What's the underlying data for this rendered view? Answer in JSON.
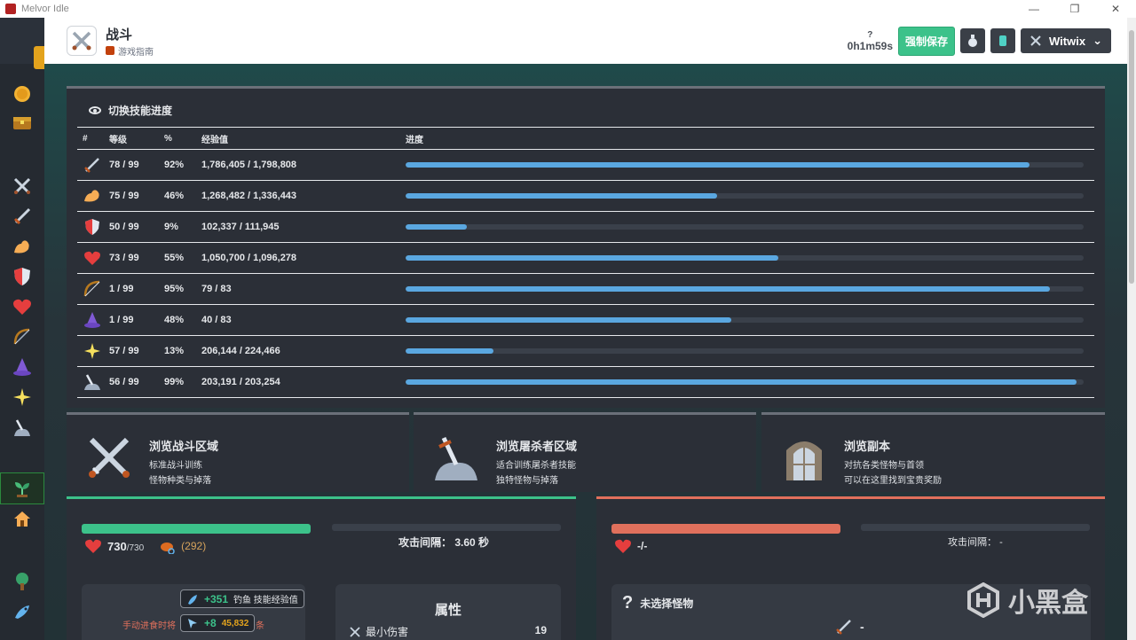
{
  "window": {
    "title": "Melvor Idle"
  },
  "header": {
    "page_title": "战斗",
    "guide_label": "游戏指南",
    "timer_help": "?",
    "timer": "0h1m59s",
    "save_button": "强制保存",
    "username": "Witwix",
    "dropdown_icon": "chevron-down-icon"
  },
  "sidebar": {
    "items": [
      "gp-coin-icon",
      "bank-chest-icon",
      "combat-swords-icon",
      "attack-sword-icon",
      "strength-arm-icon",
      "defence-shield-icon",
      "hitpoints-heart-icon",
      "ranged-bow-icon",
      "magic-hat-icon",
      "prayer-sparkle-icon",
      "slayer-sword-rock-icon",
      "farming-sprout-icon",
      "township-icon",
      "woodcutting-tree-icon",
      "fishing-icon"
    ]
  },
  "skills_panel": {
    "toggle_label": "切换技能进度",
    "headers": {
      "num": "#",
      "level": "等级",
      "percent": "%",
      "xp": "经验值",
      "progress": "进度"
    },
    "rows": [
      {
        "icon": "attack-sword-icon",
        "level": "78 / 99",
        "percent": "92%",
        "xp": "1,786,405 / 1,798,808",
        "progress": 0.92
      },
      {
        "icon": "strength-arm-icon",
        "level": "75 / 99",
        "percent": "46%",
        "xp": "1,268,482 / 1,336,443",
        "progress": 0.46
      },
      {
        "icon": "defence-shield-icon",
        "level": "50 / 99",
        "percent": "9%",
        "xp": "102,337 / 111,945",
        "progress": 0.09
      },
      {
        "icon": "hitpoints-heart-icon",
        "level": "73 / 99",
        "percent": "55%",
        "xp": "1,050,700 / 1,096,278",
        "progress": 0.55
      },
      {
        "icon": "ranged-bow-icon",
        "level": "1 / 99",
        "percent": "95%",
        "xp": "79 / 83",
        "progress": 0.95
      },
      {
        "icon": "magic-hat-icon",
        "level": "1 / 99",
        "percent": "48%",
        "xp": "40 / 83",
        "progress": 0.48
      },
      {
        "icon": "prayer-sparkle-icon",
        "level": "57 / 99",
        "percent": "13%",
        "xp": "206,144 / 224,466",
        "progress": 0.13
      },
      {
        "icon": "slayer-sword-rock-icon",
        "level": "56 / 99",
        "percent": "99%",
        "xp": "203,191 / 203,254",
        "progress": 0.99
      }
    ]
  },
  "cards": [
    {
      "title": "浏览战斗区域",
      "line1": "标准战斗训练",
      "line2": "怪物种类与掉落",
      "icon": "crossed-swords-icon"
    },
    {
      "title": "浏览屠杀者区域",
      "line1": "适合训练屠杀者技能",
      "line2": "独特怪物与掉落",
      "icon": "slayer-sword-rock-icon"
    },
    {
      "title": "浏览副本",
      "line1": "对抗各类怪物与首领",
      "line2": "可以在这里找到宝贵奖励",
      "icon": "dungeon-door-icon"
    }
  ],
  "player": {
    "hp": "730",
    "hp_max": "/730",
    "prayer_points": "(292)",
    "attack_interval_label": "攻击间隔：",
    "attack_interval": "3.60 秒",
    "hp_fill": 1.0,
    "badge1_value": "+351",
    "badge1_text": "钓鱼 技能经验值",
    "badge2_value": "+8",
    "badge2_count": "45,832",
    "auto_eat_text": "手动进食时将",
    "auto_eat_tail": "条",
    "stats_title": "属性",
    "stat_min_damage_label": "最小伤害",
    "stat_min_damage": "19"
  },
  "enemy": {
    "hp": "-/-",
    "attack_interval_label": "攻击间隔：",
    "attack_interval": "-",
    "hp_fill": 1.0,
    "no_monster": "未选择怪物",
    "stat_value": "-"
  },
  "watermark": {
    "text": "小黑盒"
  },
  "colors": {
    "accent_green": "#3cc28a",
    "enemy_red": "#e0705c",
    "progress_blue": "#5aa7e0",
    "panel": "#2b2f37"
  }
}
